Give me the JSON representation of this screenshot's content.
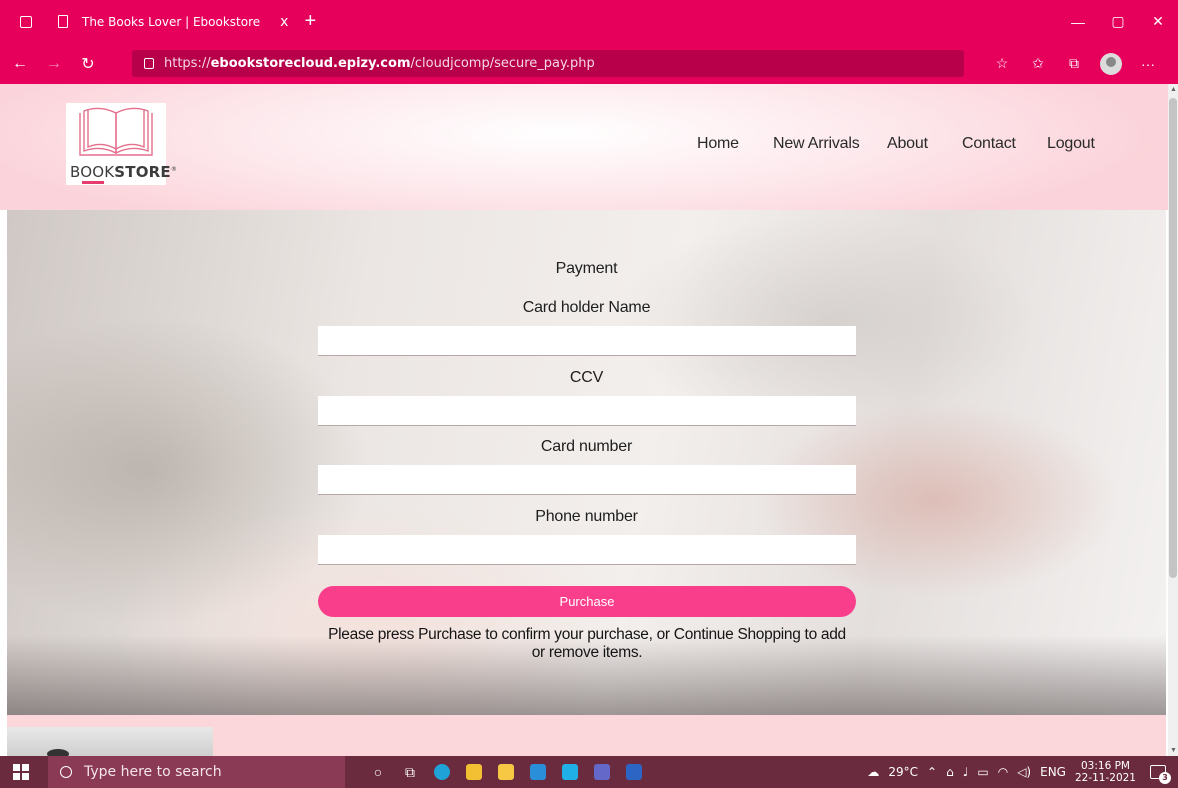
{
  "browser": {
    "tab_title": "The Books Lover | Ebookstore",
    "tab_close": "x",
    "new_tab": "+",
    "url_prefix": "https://",
    "url_domain": "ebookstorecloud.epizy.com",
    "url_path": "/cloudjcomp/secure_pay.php"
  },
  "site": {
    "logo_text_light": "BOOK",
    "logo_text_bold": "STORE",
    "logo_mark": "®",
    "nav": [
      "Home",
      "New Arrivals",
      "About",
      "Contact",
      "Logout"
    ]
  },
  "payment_form": {
    "heading": "Payment",
    "card_holder_label": "Card holder Name",
    "card_holder_value": "",
    "ccv_label": "CCV",
    "ccv_value": "",
    "card_number_label": "Card number",
    "card_number_value": "",
    "phone_label": "Phone number",
    "phone_value": "",
    "purchase_button": "Purchase",
    "note": "Please press Purchase to confirm your purchase, or Continue Shopping to add or remove items."
  },
  "taskbar": {
    "search_placeholder": "Type here to search",
    "weather": "29°C",
    "language": "ENG",
    "time": "03:16 PM",
    "date": "22-11-2021",
    "notification_count": "3"
  },
  "colors": {
    "browser_accent": "#e6005c",
    "purchase_button": "#f93f8c",
    "taskbar": "#6b2b3f"
  }
}
